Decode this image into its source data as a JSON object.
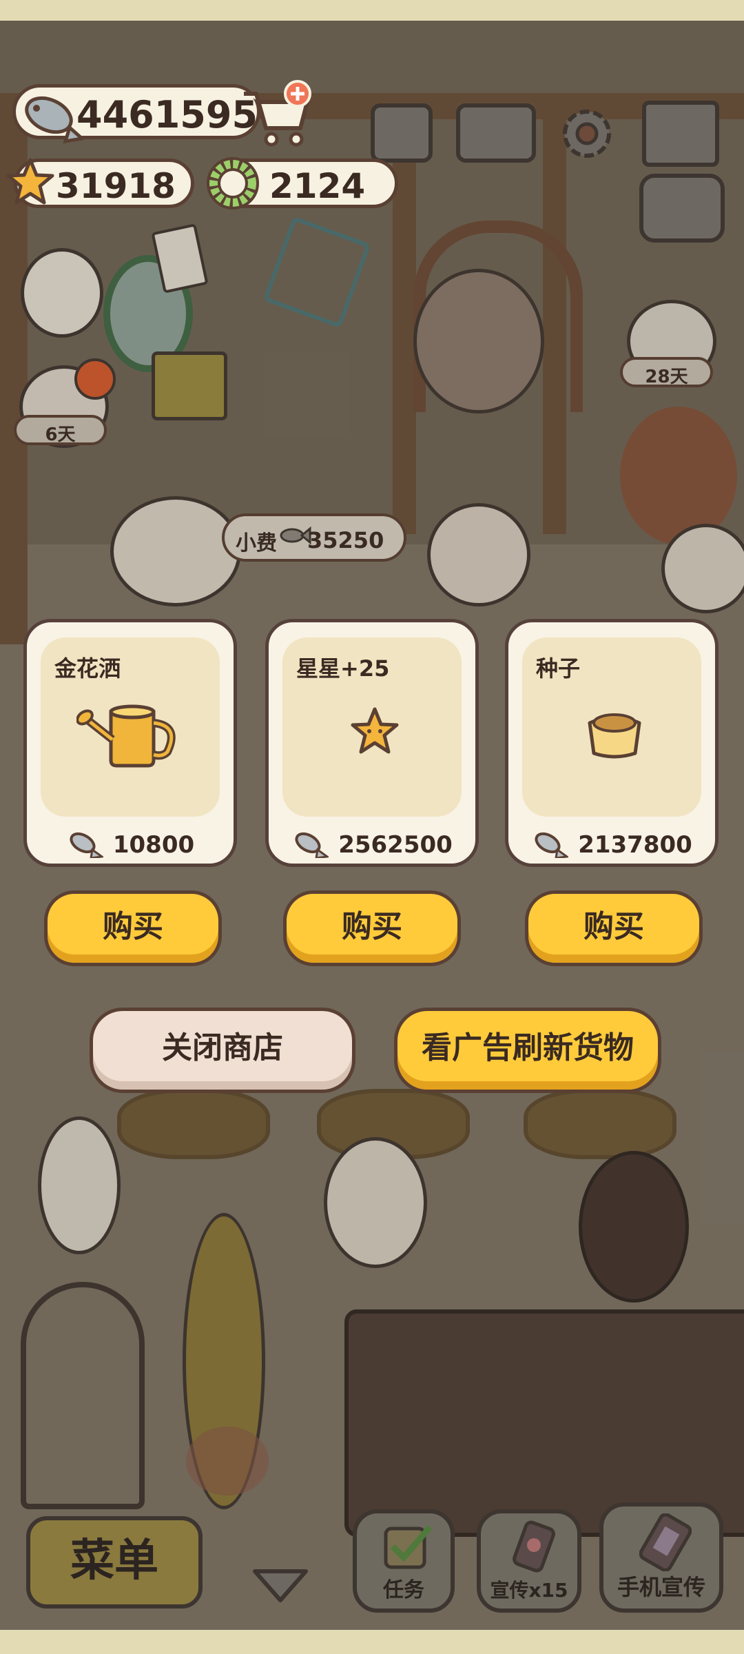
{
  "hud": {
    "fish_count": "4461595",
    "star_count": "31918",
    "ring_count": "2124"
  },
  "scene": {
    "cat_left_days": "6天",
    "cat_right_days": "28天",
    "tip_label": "小费",
    "tip_amount": "35250"
  },
  "shop": {
    "items": [
      {
        "name": "金花洒",
        "price": "10800",
        "icon": "watering-can-icon"
      },
      {
        "name": "星星+25",
        "price": "2562500",
        "icon": "star-icon"
      },
      {
        "name": "种子",
        "price": "2137800",
        "icon": "seed-bag-icon"
      }
    ],
    "buy_label": "购买",
    "close_label": "关闭商店",
    "refresh_label": "看广告刷新货物"
  },
  "bottom": {
    "menu_label": "菜单",
    "tasks_label": "任务",
    "promo_label": "宣传x15",
    "phone_promo_label": "手机宣传"
  },
  "colors": {
    "accent_yellow": "#ffcb3a",
    "card_bg": "#f9f3e6",
    "close_btn_bg": "#f0dfd2"
  }
}
